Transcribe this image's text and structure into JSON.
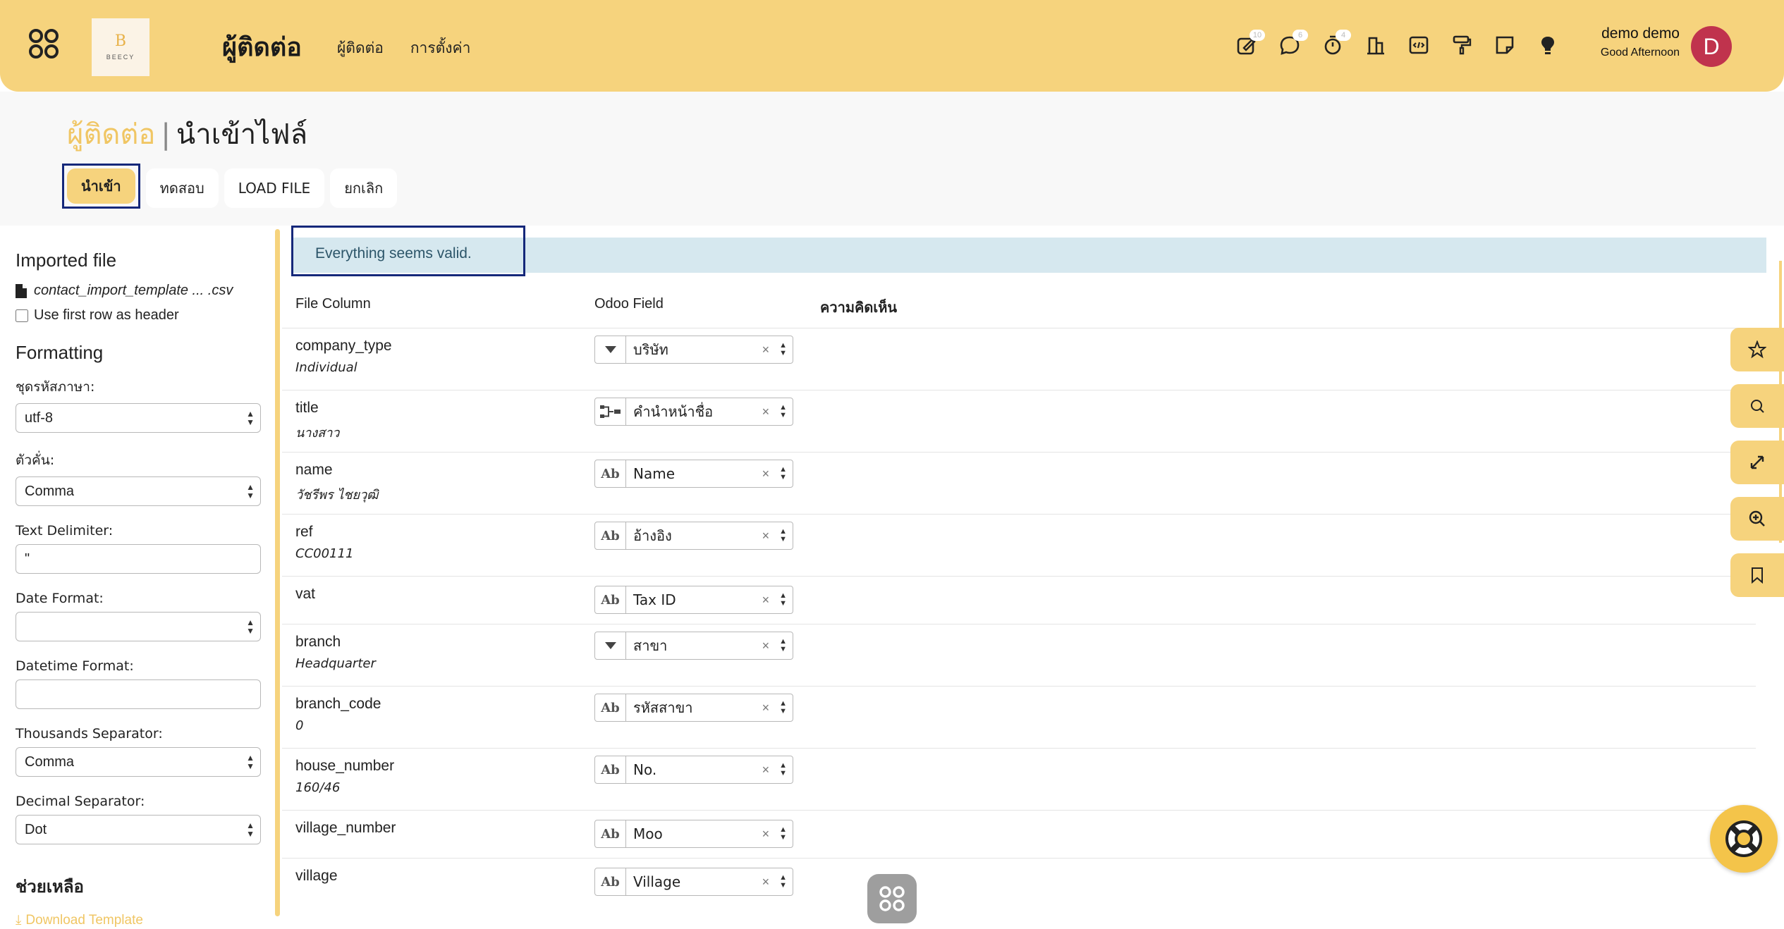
{
  "topbar": {
    "logo_text": "BEECY",
    "logo_mark": "B",
    "title": "ผู้ติดต่อ",
    "menu": [
      "ผู้ติดต่อ",
      "การตั้งค่า"
    ],
    "badges": {
      "activity": "10",
      "messages": "6",
      "timer": "4"
    },
    "user_name": "demo demo",
    "greeting": "Good Afternoon",
    "avatar_letter": "D",
    "accent_color": "#f6d37d",
    "avatar_color": "#c0334d"
  },
  "breadcrumb": {
    "parent": "ผู้ติดต่อ",
    "separator": "|",
    "current": "นำเข้าไฟล์"
  },
  "actions": {
    "import": "นำเข้า",
    "test": "ทดสอบ",
    "load_file": "LOAD FILE",
    "cancel": "ยกเลิก"
  },
  "sidebar": {
    "imported_title": "Imported file",
    "file_name": "contact_import_template ... .csv",
    "first_row_header": "Use first row as header",
    "formatting_title": "Formatting",
    "encoding_label": "ชุดรหัสภาษา:",
    "encoding_value": "utf-8",
    "separator_label": "ตัวคั่น:",
    "separator_value": "Comma",
    "text_delim_label": "Text Delimiter:",
    "text_delim_value": "\"",
    "date_format_label": "Date Format:",
    "date_format_value": "",
    "datetime_format_label": "Datetime Format:",
    "datetime_format_value": "",
    "thousands_label": "Thousands Separator:",
    "thousands_value": "Comma",
    "decimal_label": "Decimal Separator:",
    "decimal_value": "Dot",
    "help_title": "ช่วยเหลือ",
    "download_template": "Download Template"
  },
  "main": {
    "valid_message": "Everything seems valid.",
    "headers": {
      "file_column": "File Column",
      "odoo_field": "Odoo Field",
      "comments": "ความคิดเห็น"
    },
    "rows": [
      {
        "column": "company_type",
        "sample": "Individual",
        "icon": "dropdown",
        "field": "บริษัท"
      },
      {
        "column": "title",
        "sample": "นางสาว",
        "icon": "relation",
        "field": "คำนำหน้าชื่อ"
      },
      {
        "column": "name",
        "sample": "วัชรีพร ไชยวุฒิ",
        "icon": "Ab",
        "field": "Name"
      },
      {
        "column": "ref",
        "sample": "CC00111",
        "icon": "Ab",
        "field": "อ้างอิง"
      },
      {
        "column": "vat",
        "sample": "",
        "icon": "Ab",
        "field": "Tax ID"
      },
      {
        "column": "branch",
        "sample": "Headquarter",
        "icon": "dropdown",
        "field": "สาขา"
      },
      {
        "column": "branch_code",
        "sample": "0",
        "icon": "Ab",
        "field": "รหัสสาขา"
      },
      {
        "column": "house_number",
        "sample": "160/46",
        "icon": "Ab",
        "field": "No."
      },
      {
        "column": "village_number",
        "sample": "",
        "icon": "Ab",
        "field": "Moo"
      },
      {
        "column": "village",
        "sample": "",
        "icon": "Ab",
        "field": "Village"
      }
    ]
  }
}
